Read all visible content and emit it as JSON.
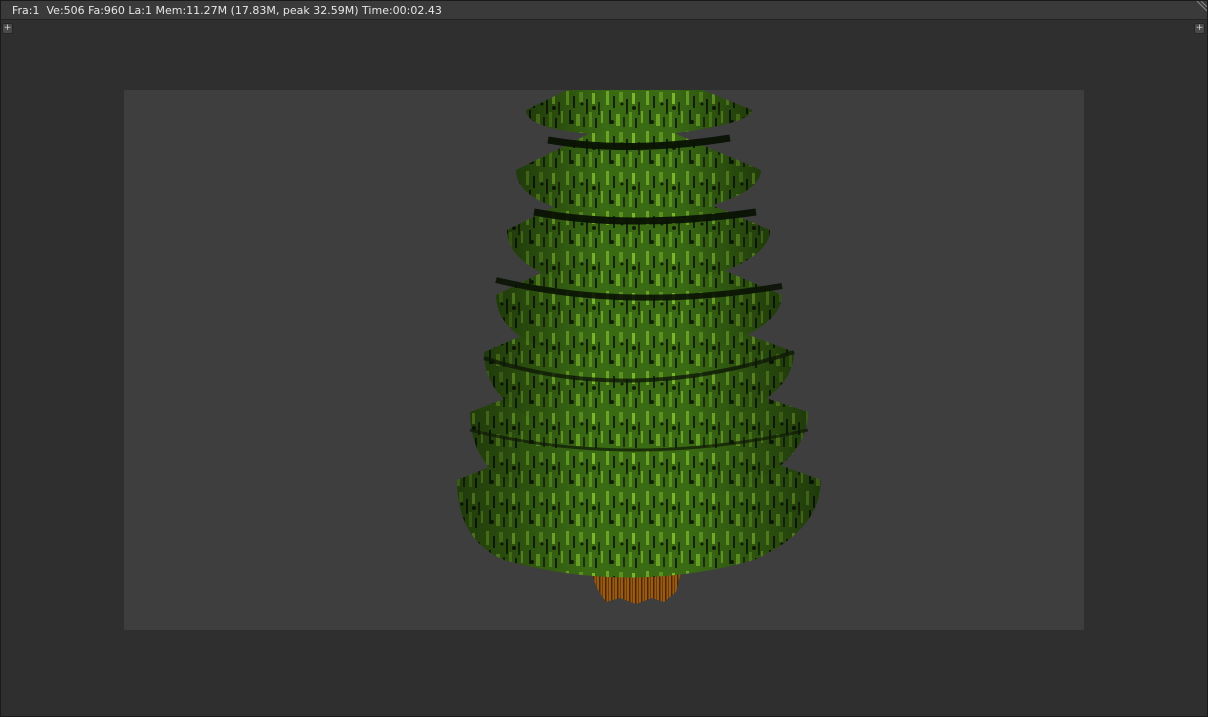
{
  "render_window": {
    "status": {
      "frame_label": "Fra:1",
      "vertices_label": "Ve:506",
      "faces_label": "Fa:960",
      "lamps_label": "La:1",
      "memory_label": "Mem:11.27M (17.83M, peak 32.59M)",
      "time_label": "Time:00:02.43"
    },
    "buttons": {
      "left_icon": "plus-icon",
      "right_icon": "plus-icon"
    },
    "render_image": {
      "subject": "pine-tree-icon",
      "colors": {
        "background": "#3e3e3e",
        "foliage_dark": "#142408",
        "foliage_mid": "#3a6a14",
        "foliage_light": "#6aa326",
        "trunk": "#9a5a14",
        "trunk_dark": "#4a2806"
      }
    }
  }
}
